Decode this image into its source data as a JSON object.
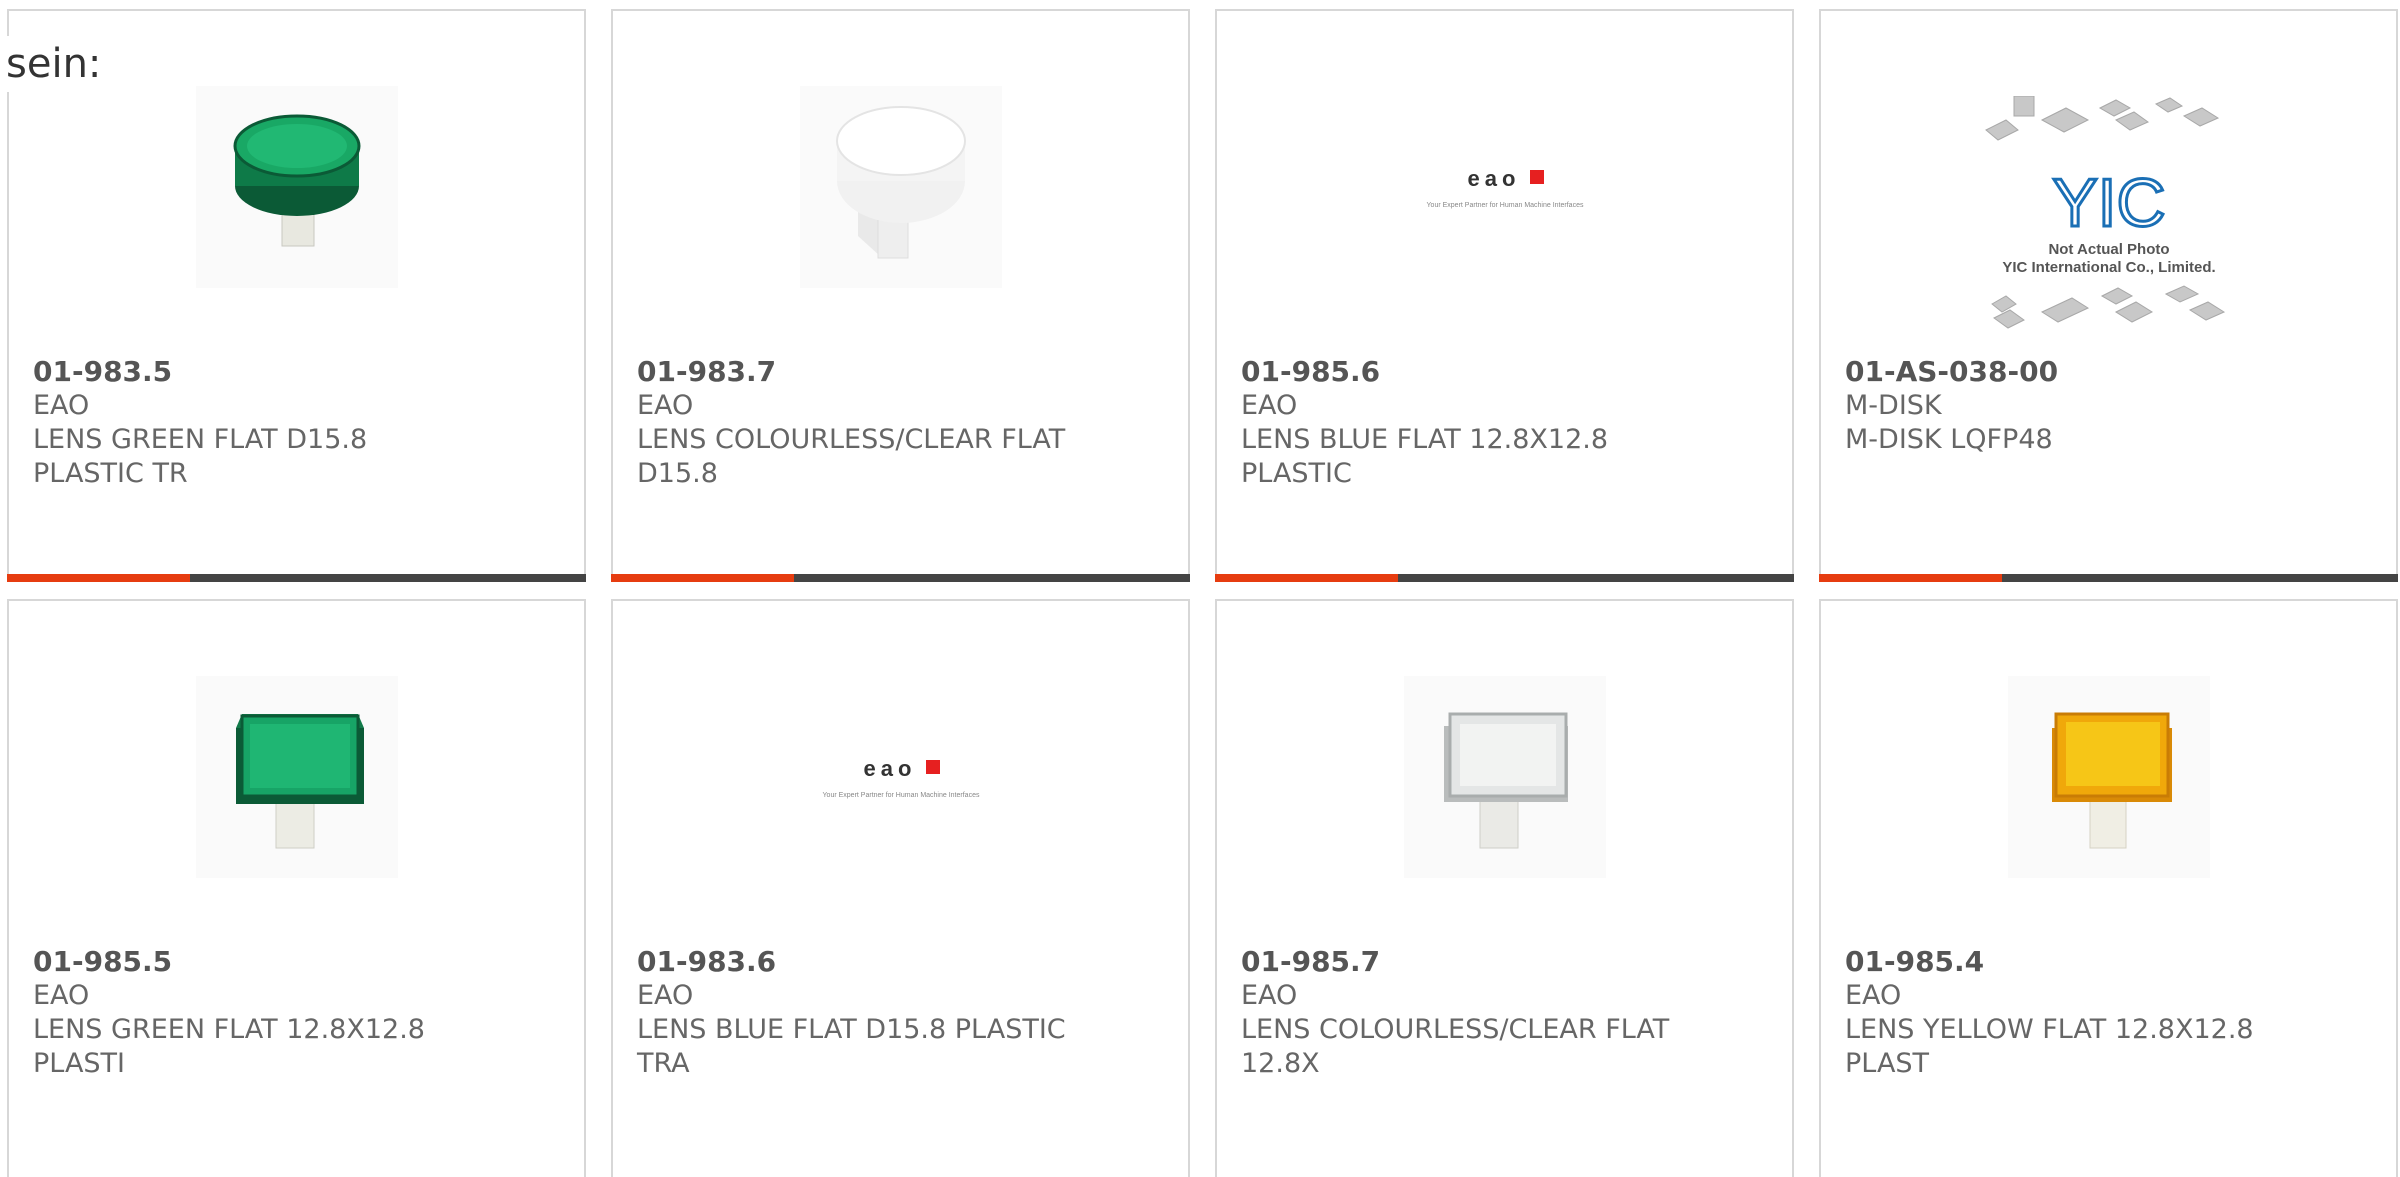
{
  "intro_text": "sein:",
  "accent_color": "#e63c10",
  "products": [
    {
      "part_number": "01-983.5",
      "manufacturer": "EAO",
      "description": [
        "LENS GREEN FLAT D15.8",
        "PLASTIC TR"
      ],
      "image": "green-round-lens"
    },
    {
      "part_number": "01-983.7",
      "manufacturer": "EAO",
      "description": [
        "LENS COLOURLESS/CLEAR FLAT",
        "D15.8"
      ],
      "image": "white-round-lens"
    },
    {
      "part_number": "01-985.6",
      "manufacturer": "EAO",
      "description": [
        "LENS BLUE FLAT 12.8X12.8",
        "PLASTIC"
      ],
      "image": "eao-logo"
    },
    {
      "part_number": "01-AS-038-00",
      "manufacturer": "M-DISK",
      "description": [
        "M-DISK LQFP48",
        ""
      ],
      "image": "yic-placeholder",
      "image_caption": [
        "Not Actual Photo",
        "YIC International Co., Limited."
      ],
      "logo_text": "YIC"
    },
    {
      "part_number": "01-985.5",
      "manufacturer": "EAO",
      "description": [
        "LENS GREEN FLAT 12.8X12.8",
        "PLASTI"
      ],
      "image": "green-square-lens"
    },
    {
      "part_number": "01-983.6",
      "manufacturer": "EAO",
      "description": [
        "LENS BLUE FLAT D15.8 PLASTIC",
        "TRA"
      ],
      "image": "eao-logo"
    },
    {
      "part_number": "01-985.7",
      "manufacturer": "EAO",
      "description": [
        "LENS COLOURLESS/CLEAR FLAT",
        "12.8X"
      ],
      "image": "clear-square-lens"
    },
    {
      "part_number": "01-985.4",
      "manufacturer": "EAO",
      "description": [
        "LENS YELLOW FLAT 12.8X12.8",
        "PLAST"
      ],
      "image": "yellow-square-lens"
    }
  ],
  "eao_logo": {
    "wordmark": "eao",
    "tagline": "Your Expert Partner for Human Machine Interfaces"
  }
}
